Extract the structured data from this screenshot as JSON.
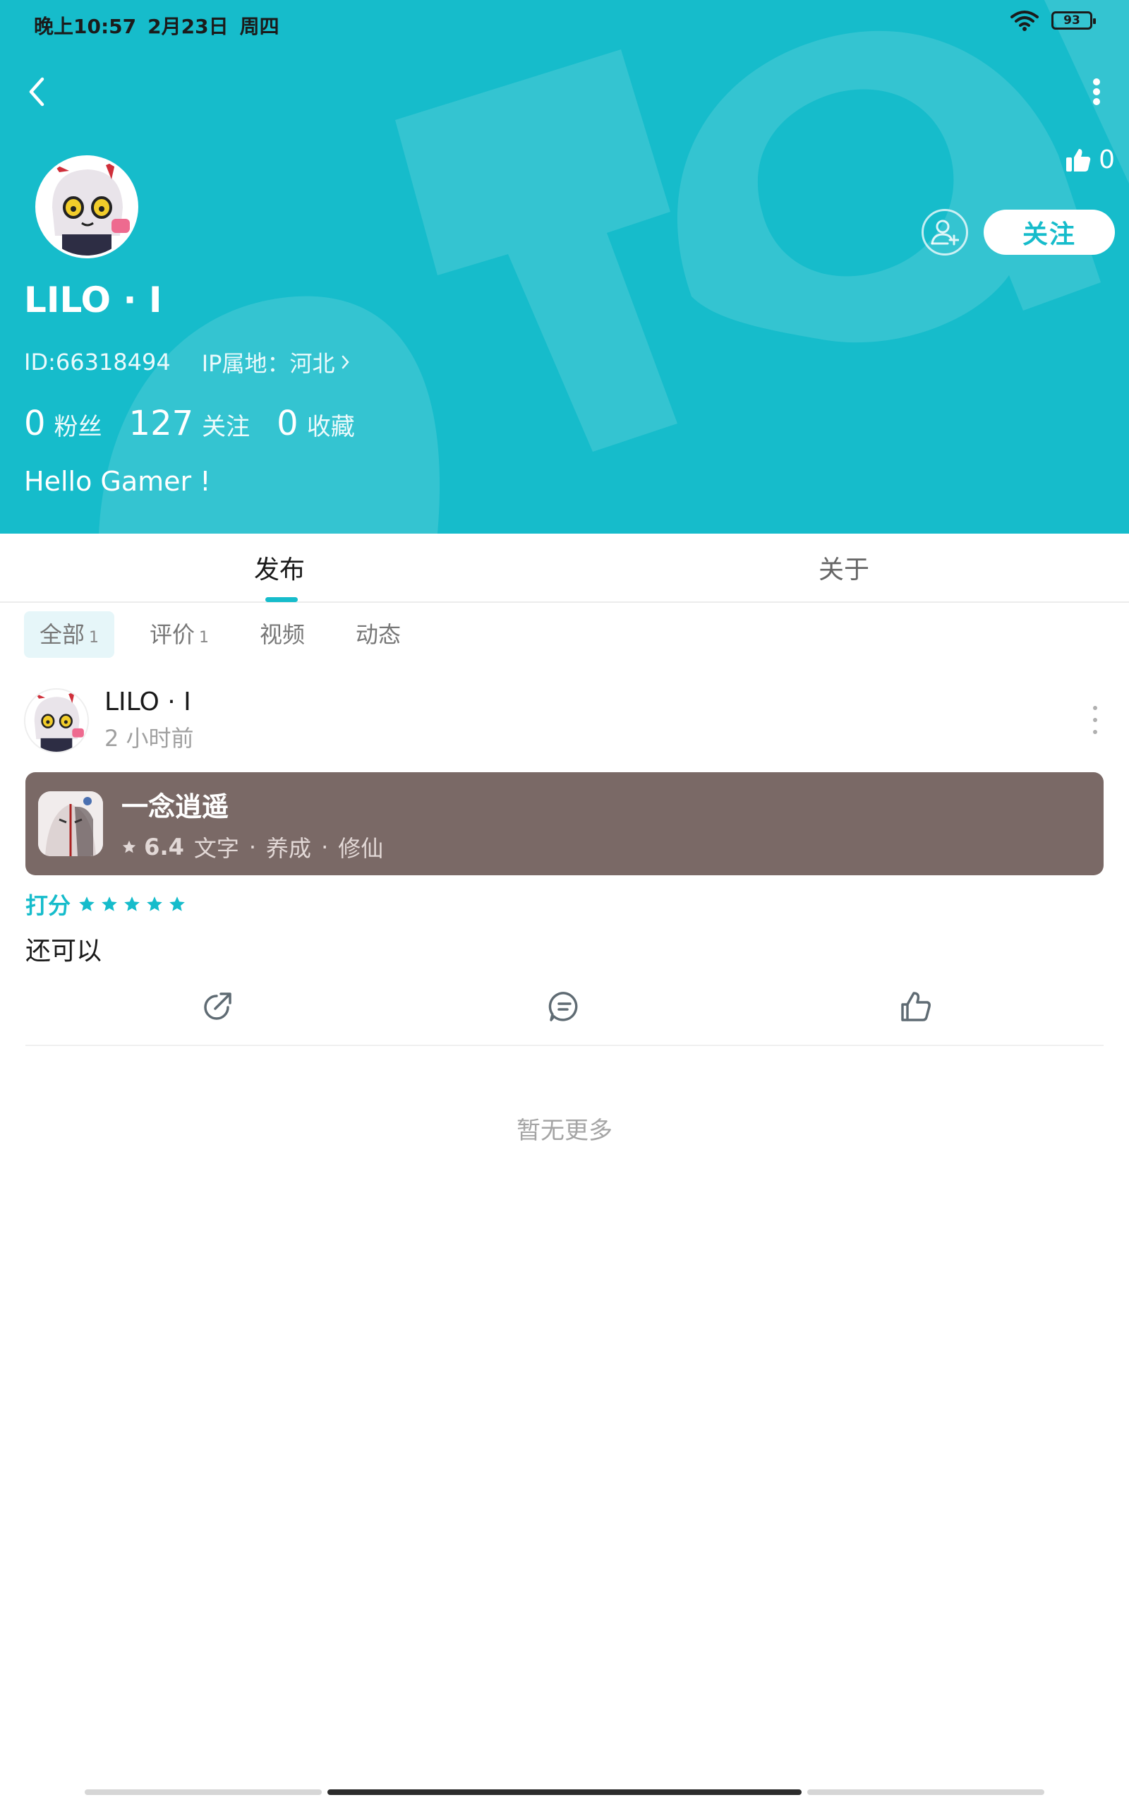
{
  "status_bar": {
    "time": "晚上10:57",
    "date": "2月23日",
    "weekday": "周四",
    "battery": "93"
  },
  "profile": {
    "likes": "0",
    "follow_label": "关注",
    "username": "LILO · I",
    "id_text": "ID:66318494",
    "ip_text": "IP属地：河北",
    "stats": [
      {
        "num": "0",
        "label": "粉丝"
      },
      {
        "num": "127",
        "label": "关注"
      },
      {
        "num": "0",
        "label": "收藏"
      }
    ],
    "bio": "Hello Gamer !"
  },
  "tabs": [
    {
      "label": "发布"
    },
    {
      "label": "关于"
    }
  ],
  "filters": [
    {
      "label": "全部",
      "count": "1"
    },
    {
      "label": "评价",
      "count": "1"
    },
    {
      "label": "视频",
      "count": ""
    },
    {
      "label": "动态",
      "count": ""
    }
  ],
  "post": {
    "author": "LILO · I",
    "time": "2 小时前",
    "game": {
      "title": "一念逍遥",
      "score": "6.4",
      "tags": [
        "文字",
        "养成",
        "修仙"
      ]
    },
    "rating_label": "打分",
    "rating_stars": 5,
    "text": "还可以"
  },
  "footer": {
    "no_more": "暂无更多"
  },
  "colors": {
    "accent": "#16bccb",
    "game_card": "#7a6966"
  }
}
